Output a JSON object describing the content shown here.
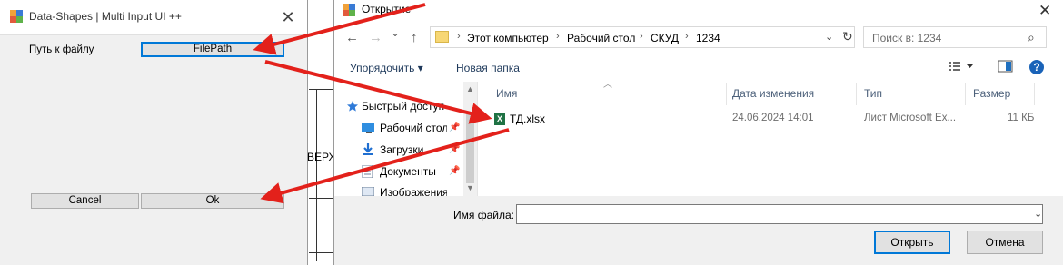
{
  "background_text": "ВЕРХ",
  "left_window": {
    "title": "Data-Shapes | Multi Input UI ++",
    "close_glyph": "✕",
    "path_label": "Путь к файлу",
    "filepath_button": "FilePath",
    "cancel_button": "Cancel",
    "ok_button": "Ok"
  },
  "dialog": {
    "title": "Открытие",
    "close_glyph": "✕",
    "nav": {
      "back": "←",
      "forward": "→",
      "recent": "⌄",
      "up": "↑"
    },
    "breadcrumb": [
      "Этот компьютер",
      "Рабочий стол",
      "СКУД",
      "1234"
    ],
    "search_placeholder": "Поиск в: 1234",
    "toolbar": {
      "organize": "Упорядочить ▾",
      "new_folder": "Новая папка"
    },
    "nav_pane": [
      {
        "label": "Быстрый доступ",
        "icon": "star-icon"
      },
      {
        "label": "Рабочий стол",
        "icon": "desktop-icon"
      },
      {
        "label": "Загрузки",
        "icon": "download-icon"
      },
      {
        "label": "Документы",
        "icon": "document-icon"
      },
      {
        "label": "Изображения",
        "icon": "image-icon"
      }
    ],
    "columns": {
      "name": "Имя",
      "date": "Дата изменения",
      "type": "Тип",
      "size": "Размер"
    },
    "files": [
      {
        "name": "ТД.xlsx",
        "date": "24.06.2024 14:01",
        "type": "Лист Microsoft Ex...",
        "size": "11 КБ"
      }
    ],
    "filename_label": "Имя файла:",
    "filename_value": "",
    "open_button": "Открыть",
    "cancel_button": "Отмена"
  },
  "colors": {
    "arrow": "#e3211b",
    "accent": "#0078d7"
  }
}
